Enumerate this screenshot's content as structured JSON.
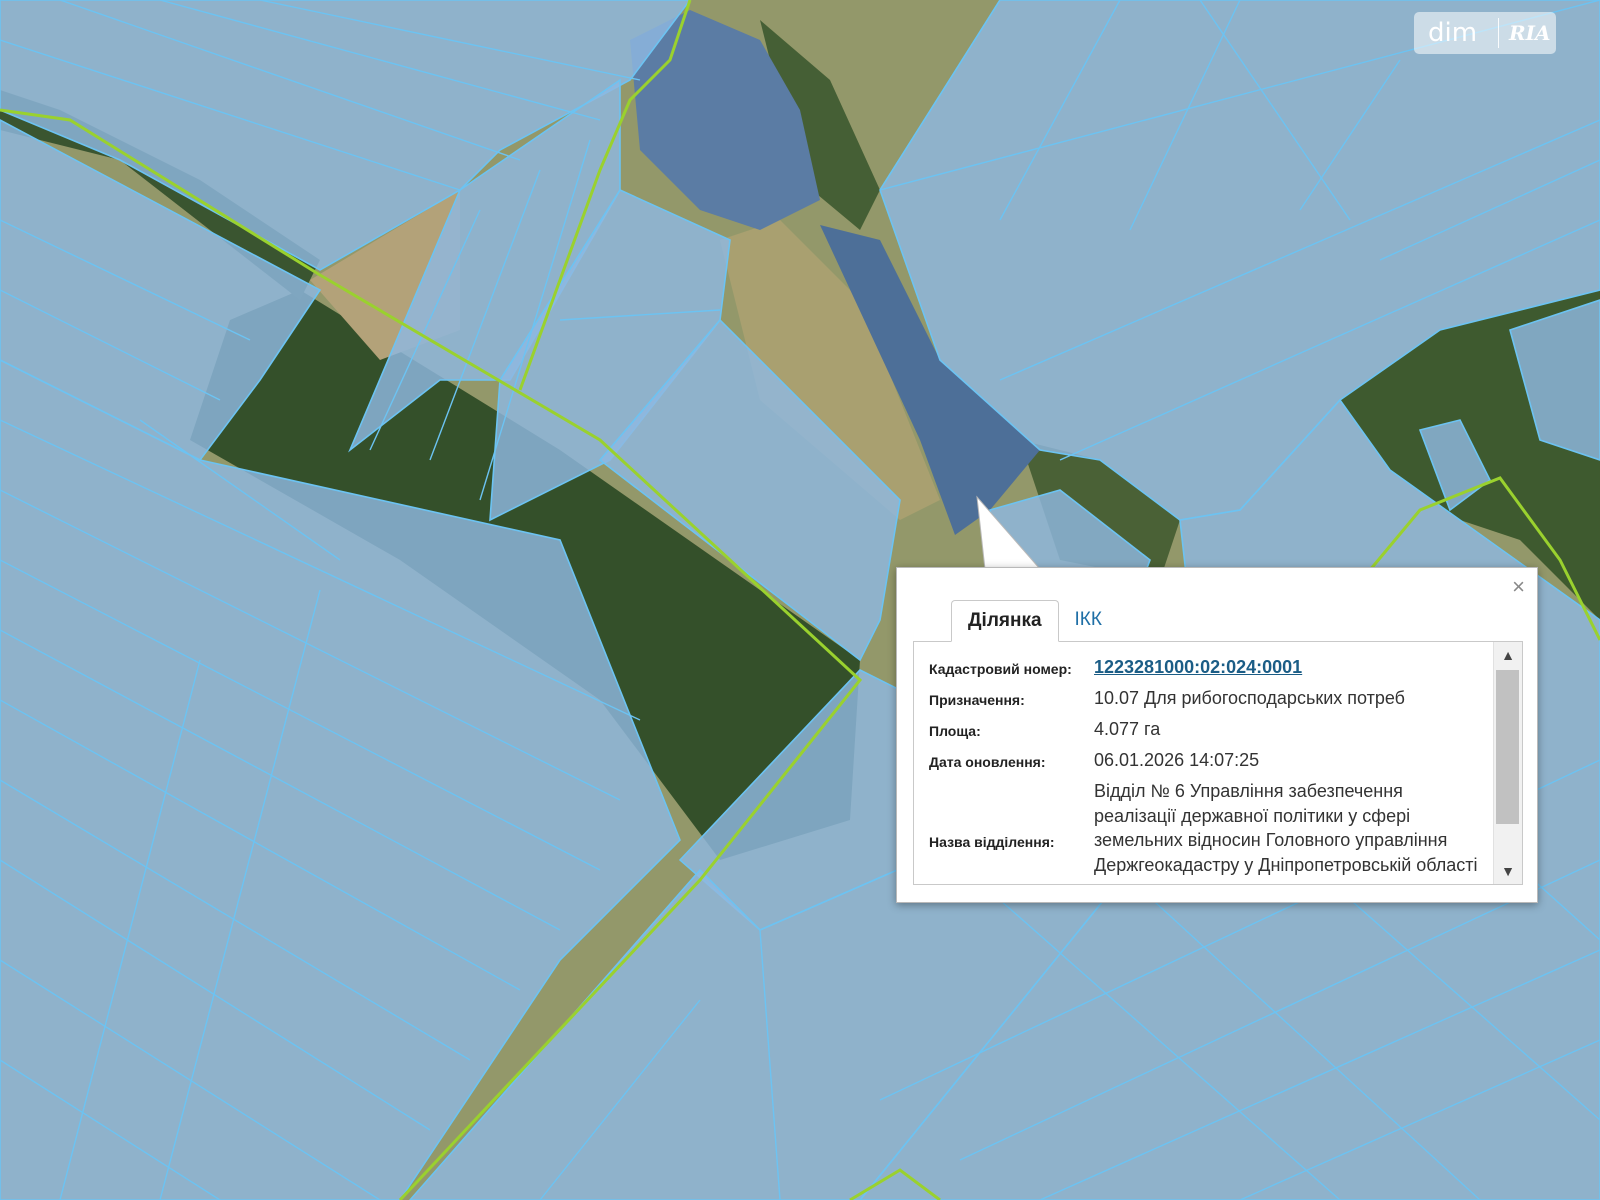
{
  "watermark": {
    "brand_dim": "dim",
    "brand_ria": "RIA"
  },
  "popup": {
    "close_glyph": "×",
    "tabs": [
      {
        "label": "Ділянка",
        "active": true
      },
      {
        "label": "ІКК",
        "active": false
      }
    ],
    "fields": {
      "cadastral_label": "Кадастровий номер:",
      "cadastral_value": "1223281000:02:024:0001",
      "purpose_label": "Призначення:",
      "purpose_value": "10.07 Для рибогосподарських потреб",
      "area_label": "Площа:",
      "area_value": "4.077 га",
      "updated_label": "Дата оновлення:",
      "updated_value": "06.01.2026 14:07:25",
      "office_label": "Назва відділення:",
      "office_value": "Відділ № 6 Управління забезпечення реалізації державної політики у сфері земельних відносин Головного управління Держгеокадастру у Дніпропетровській області"
    },
    "scroll_up_glyph": "▲",
    "scroll_down_glyph": "▼"
  },
  "colors": {
    "parcel_fill": "#8fb8e0",
    "parcel_stroke": "#6cc3f2",
    "boundary_line": "#9ad12e",
    "forest": "#2f4a22",
    "water": "#4a6f9a",
    "field": "#9c9a6a",
    "link": "#1b5d86"
  }
}
